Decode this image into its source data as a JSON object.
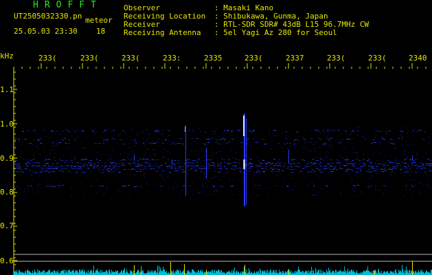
{
  "app": {
    "title": "HROFFT",
    "filename": "UT2505032330.pn",
    "mode": "meteor",
    "timestamp": "25.05.03 23:30",
    "count": "18"
  },
  "info": [
    {
      "label": "Observer",
      "value": ": Masaki Kano"
    },
    {
      "label": "Receiving Location",
      "value": ": Shibukawa, Gunma, Japan"
    },
    {
      "label": "Receiver",
      "value": ": RTL-SDR SDR# 43dB L15 96.7MHz CW"
    },
    {
      "label": "Receiving Antenna",
      "value": ": 5el Yagi Az 280 for Seoul"
    }
  ],
  "x_axis": {
    "ticks": [
      "233(",
      "233(",
      "233(",
      "233:",
      "2335",
      "233(",
      "2337",
      "233(",
      "233(",
      "2340"
    ]
  },
  "y_axis": {
    "unit": "kHz",
    "ticks": [
      "1.1",
      "1.0",
      "0.9",
      "0.8",
      "0.7",
      "0.6"
    ]
  },
  "colors": {
    "text": "#e8e800",
    "title": "#22ee22",
    "signal": "#2a3cff",
    "spectrum": "#00bcd4"
  }
}
